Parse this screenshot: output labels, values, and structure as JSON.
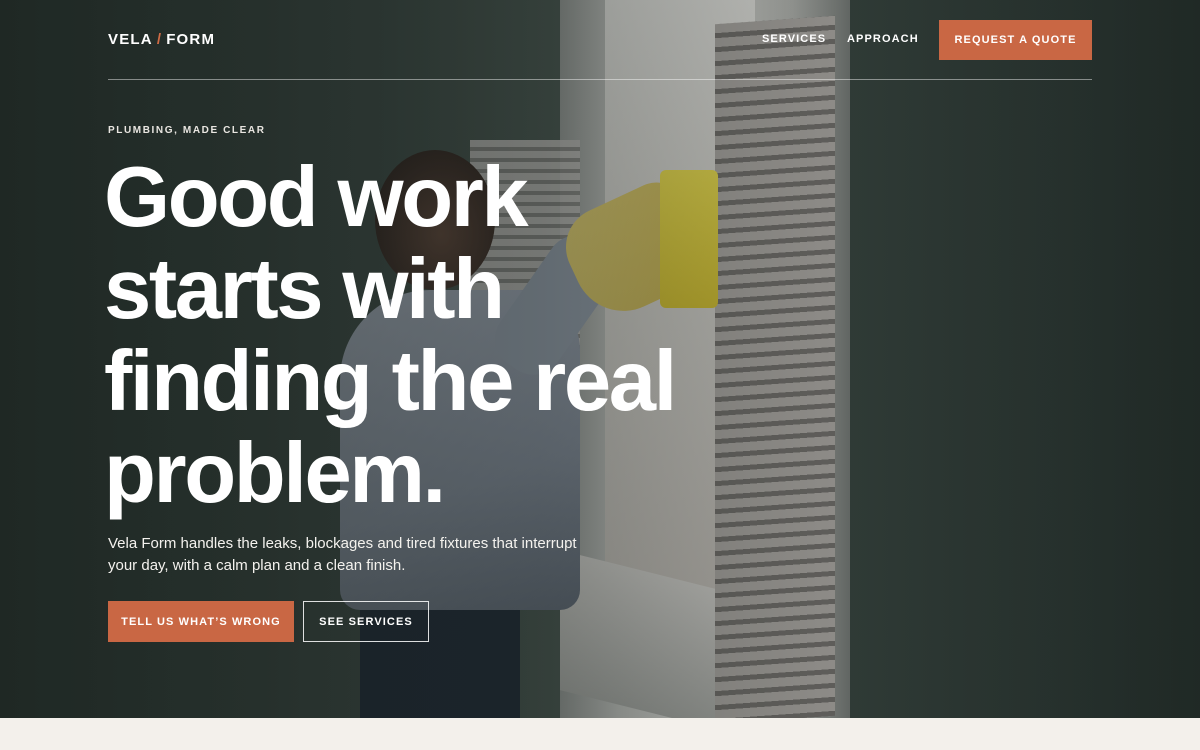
{
  "brand": {
    "name_left": "VELA",
    "separator": "/",
    "name_right": "FORM",
    "accent_color": "#c96744"
  },
  "nav": {
    "links": [
      {
        "label": "SERVICES"
      },
      {
        "label": "APPROACH"
      }
    ],
    "cta_label": "REQUEST A QUOTE"
  },
  "hero": {
    "eyebrow": "PLUMBING, MADE CLEAR",
    "headline": "Good work starts with finding the real problem.",
    "lead": "Vela Form handles the leaks, blockages and tired fixtures that interrupt your day, with a calm plan and a clean finish.",
    "primary_cta": "TELL US WHAT’S WRONG",
    "secondary_cta": "SEE SERVICES"
  }
}
